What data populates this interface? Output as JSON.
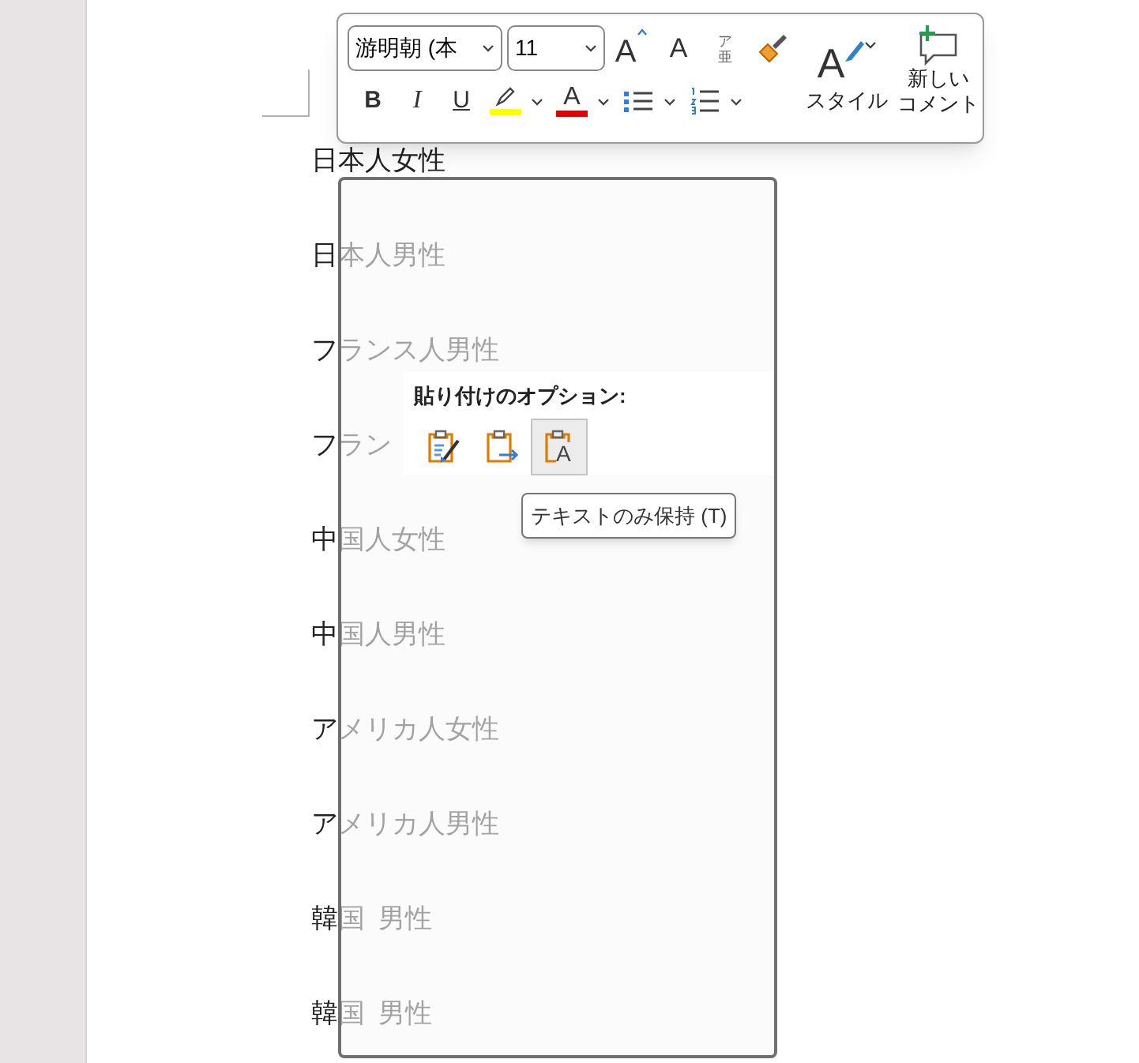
{
  "document": {
    "lines": [
      "日本人女性",
      "日本人男性",
      "フランス人男性",
      "フラン",
      "中国人女性",
      "中国人男性",
      "アメリカ人女性",
      "アメリカ人男性",
      "韓国  男性",
      "韓国  男性"
    ]
  },
  "toolbar": {
    "font": "游明朝 (本",
    "size": "11",
    "grow_font": "A",
    "shrink_font": "A",
    "phonetic": "ア亜",
    "bold": "B",
    "italic": "I",
    "underline": "U",
    "font_color": "A",
    "style_letter": "A",
    "style_label": "スタイル",
    "comment_label": [
      "新しい",
      "コメント"
    ]
  },
  "paste_options": {
    "title": "貼り付けのオプション:",
    "options": [
      {
        "kind": "formatting",
        "selected": false
      },
      {
        "kind": "merge",
        "selected": false
      },
      {
        "kind": "text",
        "letter": "A",
        "selected": true
      }
    ],
    "tooltip": "テキストのみ保持 (T)"
  }
}
